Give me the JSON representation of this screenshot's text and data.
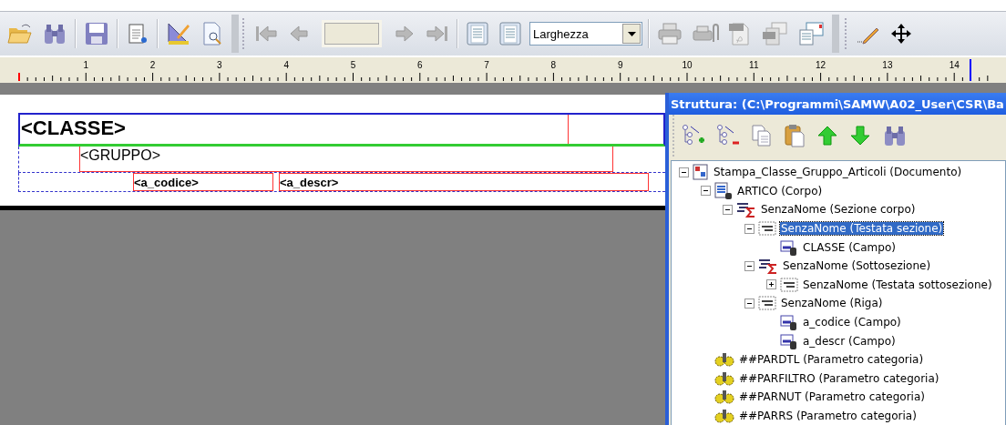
{
  "toolbar": {
    "zoom": {
      "value": "Larghezza"
    }
  },
  "ruler": {
    "labels": [
      "1",
      "2",
      "3",
      "4",
      "5",
      "6",
      "7",
      "8",
      "9",
      "10",
      "11",
      "12",
      "13",
      "14"
    ]
  },
  "design": {
    "bands": [
      {
        "kind": "title",
        "fields": [
          {
            "text": "<CLASSE>",
            "bold": true
          }
        ]
      },
      {
        "kind": "group",
        "fields": [
          {
            "text": "<GRUPPO>",
            "bold": false
          }
        ]
      },
      {
        "kind": "row",
        "fields": [
          {
            "text": "<a_codice>",
            "bold": true
          },
          {
            "text": "<a_descr>",
            "bold": true
          }
        ]
      }
    ]
  },
  "structure": {
    "title": "Struttura: (C:\\Programmi\\SAMW\\A02_User\\CSR\\Ba",
    "tree": [
      {
        "label": "Stampa_Classe_Gruppo_Articoli (Documento)",
        "kind": "document",
        "expanded": true,
        "selected": false,
        "children": [
          {
            "label": "ARTICO (Corpo)",
            "kind": "body",
            "expanded": true,
            "selected": false,
            "children": [
              {
                "label": "SenzaNome (Sezione corpo)",
                "kind": "section",
                "expanded": true,
                "selected": false,
                "children": [
                  {
                    "label": "SenzaNome (Testata sezione)",
                    "kind": "header",
                    "expanded": true,
                    "selected": true,
                    "children": [
                      {
                        "label": "CLASSE (Campo)",
                        "kind": "field",
                        "selected": false
                      }
                    ]
                  },
                  {
                    "label": "SenzaNome (Sottosezione)",
                    "kind": "section",
                    "expanded": true,
                    "selected": false,
                    "children": [
                      {
                        "label": "SenzaNome (Testata sottosezione)",
                        "kind": "header",
                        "expanded": false,
                        "selected": false
                      }
                    ]
                  },
                  {
                    "label": "SenzaNome (Riga)",
                    "kind": "header",
                    "expanded": true,
                    "selected": false,
                    "children": [
                      {
                        "label": "a_codice (Campo)",
                        "kind": "field",
                        "selected": false
                      },
                      {
                        "label": "a_descr (Campo)",
                        "kind": "field",
                        "selected": false
                      }
                    ]
                  }
                ]
              }
            ]
          },
          {
            "label": "##PARDTL (Parametro categoria)",
            "kind": "param",
            "selected": false
          },
          {
            "label": "##PARFILTRO (Parametro categoria)",
            "kind": "param",
            "selected": false
          },
          {
            "label": "##PARNUT (Parametro categoria)",
            "kind": "param",
            "selected": false
          },
          {
            "label": "##PARRS (Parametro categoria)",
            "kind": "param",
            "selected": false
          }
        ]
      }
    ]
  }
}
